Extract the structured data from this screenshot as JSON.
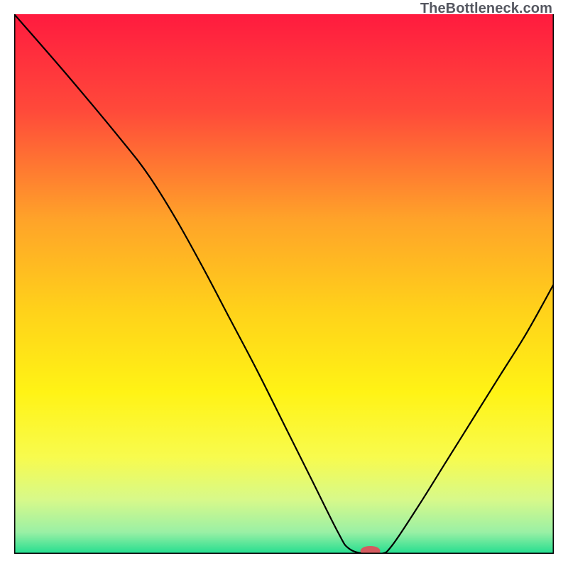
{
  "watermark": "TheBottleneck.com",
  "chart_data": {
    "type": "line",
    "title": "",
    "xlabel": "",
    "ylabel": "",
    "xlim": [
      0,
      100
    ],
    "ylim": [
      0,
      100
    ],
    "grid": false,
    "legend": false,
    "series": [
      {
        "name": "black-curve",
        "x": [
          0,
          10,
          20,
          25,
          30,
          35,
          40,
          45,
          50,
          55,
          60,
          62,
          65,
          68,
          70,
          75,
          80,
          85,
          90,
          95,
          100
        ],
        "values": [
          100,
          88.5,
          76.5,
          70,
          62,
          53,
          43.5,
          34,
          24,
          14,
          4,
          1,
          0,
          0,
          1.5,
          9,
          17,
          25,
          33,
          41,
          50
        ]
      }
    ],
    "marker": {
      "x": 66,
      "y": 0,
      "color": "#d45a5f",
      "rx": 6,
      "ry": 3
    },
    "background_gradient": {
      "type": "vertical",
      "stops": [
        {
          "pos": 0.0,
          "color": "#ff1b3f"
        },
        {
          "pos": 0.18,
          "color": "#ff4a3a"
        },
        {
          "pos": 0.38,
          "color": "#ffa329"
        },
        {
          "pos": 0.55,
          "color": "#ffd21a"
        },
        {
          "pos": 0.7,
          "color": "#fff315"
        },
        {
          "pos": 0.82,
          "color": "#f8fb4d"
        },
        {
          "pos": 0.9,
          "color": "#d7f98a"
        },
        {
          "pos": 0.96,
          "color": "#9af0a5"
        },
        {
          "pos": 1.0,
          "color": "#22dd8f"
        }
      ]
    }
  }
}
